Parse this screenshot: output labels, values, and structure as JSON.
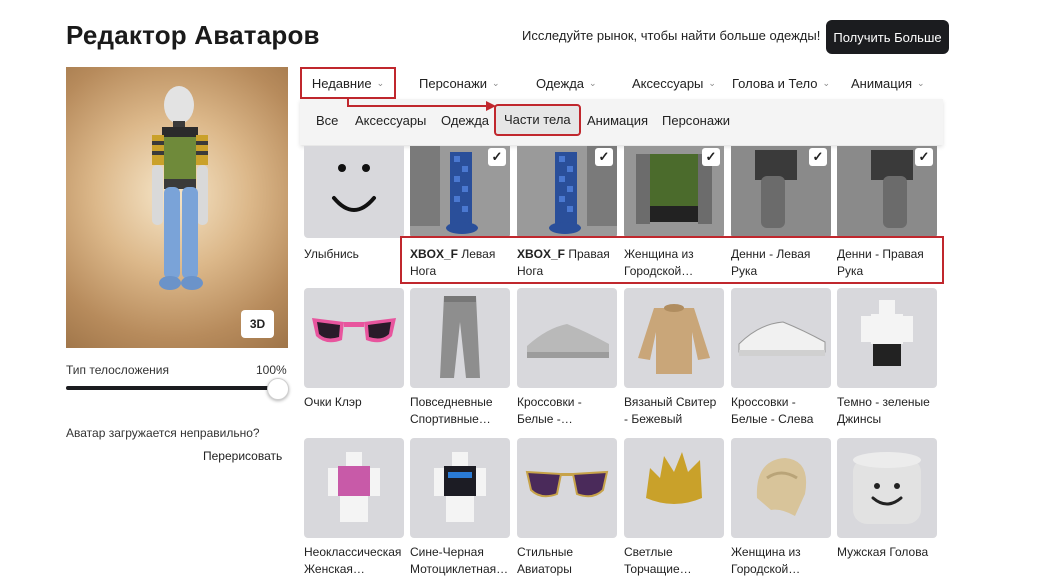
{
  "header": {
    "title": "Редактор Аватаров",
    "market_text": "Исследуйте рынок, чтобы найти больше одежды!",
    "get_more_button": "Получить Больше"
  },
  "preview": {
    "btn_3d": "3D"
  },
  "body_type": {
    "label": "Тип телосложения",
    "value": "100%"
  },
  "redraw": {
    "question": "Аватар загружается неправильно?",
    "link": "Перерисовать"
  },
  "tabs": [
    {
      "label": "Недавние"
    },
    {
      "label": "Персонажи"
    },
    {
      "label": "Одежда"
    },
    {
      "label": "Аксессуары"
    },
    {
      "label": "Голова и Тело"
    },
    {
      "label": "Анимация"
    }
  ],
  "subtabs": [
    {
      "label": "Все"
    },
    {
      "label": "Аксессуары"
    },
    {
      "label": "Одежда"
    },
    {
      "label": "Части тела"
    },
    {
      "label": "Анимация"
    },
    {
      "label": "Персонажи"
    }
  ],
  "items_row1": [
    {
      "bold": "",
      "line1": "Улыбнись",
      "line2": "",
      "checked": false
    },
    {
      "bold": "XBOX_F",
      "line1": " Левая",
      "line2": "Нога",
      "checked": true
    },
    {
      "bold": "XBOX_F",
      "line1": " Правая",
      "line2": "Нога",
      "checked": true
    },
    {
      "bold": "",
      "line1": "Женщина из",
      "line2": "Городской…",
      "checked": true
    },
    {
      "bold": "",
      "line1": "Денни - Левая",
      "line2": "Рука",
      "checked": true
    },
    {
      "bold": "",
      "line1": "Денни - Правая",
      "line2": "Рука",
      "checked": true
    }
  ],
  "items_row2": [
    {
      "line1": "Очки Клэр",
      "line2": ""
    },
    {
      "line1": "Повседневные",
      "line2": "Спортивные…"
    },
    {
      "line1": "Кроссовки -",
      "line2": "Белые -…"
    },
    {
      "line1": "Вязаный Свитер",
      "line2": "- Бежевый"
    },
    {
      "line1": "Кроссовки -",
      "line2": "Белые - Слева"
    },
    {
      "line1": "Темно - зеленые",
      "line2": "Джинсы"
    }
  ],
  "items_row3": [
    {
      "line1": "Неоклассическая",
      "line2": "Женская…"
    },
    {
      "line1": "Сине-Черная",
      "line2": "Мотоциклетная…"
    },
    {
      "line1": "Стильные",
      "line2": "Авиаторы"
    },
    {
      "line1": "Светлые",
      "line2": "Торчащие…"
    },
    {
      "line1": "Женщина из",
      "line2": "Городской…"
    },
    {
      "line1": "Мужская Голова",
      "line2": ""
    }
  ],
  "colors": {
    "accent_red": "#c0272d",
    "dark_button": "#1b1c1f",
    "tile_bg": "#d8d8dc"
  }
}
